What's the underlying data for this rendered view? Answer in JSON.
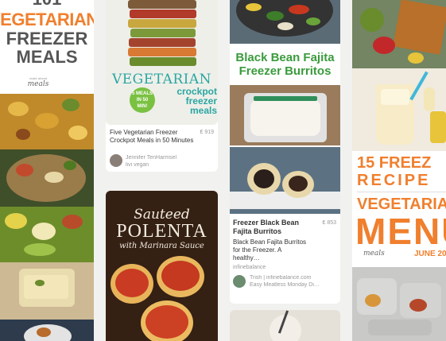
{
  "col1": {
    "title_lines": [
      "101",
      "VEGETARIAN",
      "FREEZER",
      "MEALS"
    ],
    "logo_top": "make ahead",
    "logo_main": "meals"
  },
  "col2": {
    "pin1": {
      "cover_title": "VEGETARIAN",
      "cover_sub1": "crockpot",
      "cover_sub2": "freezer",
      "cover_sub3": "meals",
      "badge": "5 MEALS IN 50 MIN!",
      "caption": "Five Vegetarian Freezer Crockpot Meals in 50 Minutes",
      "saves": "919",
      "user_name": "Jennifer TenHarmsel",
      "board": "livi vegan"
    },
    "pin2": {
      "title_line1": "Sauteed",
      "title_line2": "POLENTA",
      "title_line3": "with Marinara Sauce"
    }
  },
  "col3": {
    "banner_line1": "Black Bean Fajita",
    "banner_line2": "Freezer Burritos",
    "title": "Freezer Black Bean Fajita Burritos",
    "saves": "853",
    "description": "Black Bean Fajita Burritos for the Freezer. A healthy…",
    "source": "infinebalance",
    "user_name": "Trish | infinebalance.com",
    "board": "Easy Meatless Monday Di…"
  },
  "col4": {
    "title_line1": "15 FREEZ",
    "title_line2": "RECIPE",
    "title_line3": "VEGETARIAN",
    "title_line4": "MENU",
    "logo": "meals",
    "date": "JUNE 20"
  }
}
